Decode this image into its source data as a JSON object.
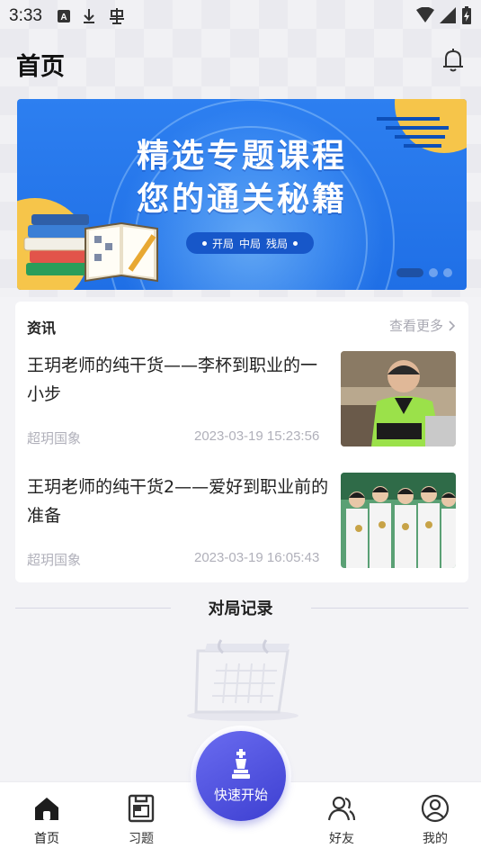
{
  "status_bar": {
    "time": "3:33",
    "icons": [
      "a-box-icon",
      "download-icon",
      "bug-icon"
    ],
    "right_icons": [
      "wifi-icon",
      "signal-icon",
      "battery-charging-icon"
    ]
  },
  "header": {
    "title": "首页",
    "bell_icon": "bell-icon"
  },
  "banner": {
    "line1": "精选专题课程",
    "line2": "您的通关秘籍",
    "pill_items": [
      "开局",
      "中局",
      "残局"
    ],
    "page_count": 3,
    "active_page": 0
  },
  "news": {
    "section_title": "资讯",
    "more_label": "查看更多",
    "items": [
      {
        "title": "王玥老师的纯干货——李杯到职业的一小步",
        "source": "超玥国象",
        "date": "2023-03-19 15:23:56"
      },
      {
        "title": "王玥老师的纯干货2——爱好到职业前的准备",
        "source": "超玥国象",
        "date": "2023-03-19 16:05:43"
      }
    ]
  },
  "records": {
    "title": "对局记录"
  },
  "tabbar": {
    "tabs": [
      {
        "label": "首页",
        "icon": "home-icon",
        "active": true
      },
      {
        "label": "习题",
        "icon": "chessboard-icon",
        "active": false
      },
      {
        "label": "好友",
        "icon": "friends-icon",
        "active": false
      },
      {
        "label": "我的",
        "icon": "profile-icon",
        "active": false
      }
    ],
    "fab_label": "快速开始",
    "fab_icon": "chess-king-icon"
  },
  "colors": {
    "accent": "#4a4ce0",
    "banner_blue": "#2d7ff0",
    "muted_text": "#b0b0ba"
  }
}
